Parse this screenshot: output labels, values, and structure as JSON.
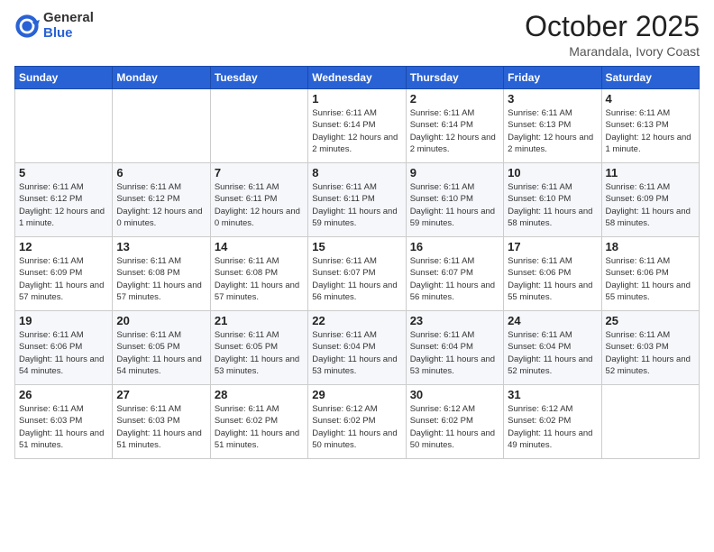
{
  "header": {
    "logo_general": "General",
    "logo_blue": "Blue",
    "month": "October 2025",
    "location": "Marandala, Ivory Coast"
  },
  "days_of_week": [
    "Sunday",
    "Monday",
    "Tuesday",
    "Wednesday",
    "Thursday",
    "Friday",
    "Saturday"
  ],
  "weeks": [
    [
      {
        "day": "",
        "info": ""
      },
      {
        "day": "",
        "info": ""
      },
      {
        "day": "",
        "info": ""
      },
      {
        "day": "1",
        "info": "Sunrise: 6:11 AM\nSunset: 6:14 PM\nDaylight: 12 hours and 2 minutes."
      },
      {
        "day": "2",
        "info": "Sunrise: 6:11 AM\nSunset: 6:14 PM\nDaylight: 12 hours and 2 minutes."
      },
      {
        "day": "3",
        "info": "Sunrise: 6:11 AM\nSunset: 6:13 PM\nDaylight: 12 hours and 2 minutes."
      },
      {
        "day": "4",
        "info": "Sunrise: 6:11 AM\nSunset: 6:13 PM\nDaylight: 12 hours and 1 minute."
      }
    ],
    [
      {
        "day": "5",
        "info": "Sunrise: 6:11 AM\nSunset: 6:12 PM\nDaylight: 12 hours and 1 minute."
      },
      {
        "day": "6",
        "info": "Sunrise: 6:11 AM\nSunset: 6:12 PM\nDaylight: 12 hours and 0 minutes."
      },
      {
        "day": "7",
        "info": "Sunrise: 6:11 AM\nSunset: 6:11 PM\nDaylight: 12 hours and 0 minutes."
      },
      {
        "day": "8",
        "info": "Sunrise: 6:11 AM\nSunset: 6:11 PM\nDaylight: 11 hours and 59 minutes."
      },
      {
        "day": "9",
        "info": "Sunrise: 6:11 AM\nSunset: 6:10 PM\nDaylight: 11 hours and 59 minutes."
      },
      {
        "day": "10",
        "info": "Sunrise: 6:11 AM\nSunset: 6:10 PM\nDaylight: 11 hours and 58 minutes."
      },
      {
        "day": "11",
        "info": "Sunrise: 6:11 AM\nSunset: 6:09 PM\nDaylight: 11 hours and 58 minutes."
      }
    ],
    [
      {
        "day": "12",
        "info": "Sunrise: 6:11 AM\nSunset: 6:09 PM\nDaylight: 11 hours and 57 minutes."
      },
      {
        "day": "13",
        "info": "Sunrise: 6:11 AM\nSunset: 6:08 PM\nDaylight: 11 hours and 57 minutes."
      },
      {
        "day": "14",
        "info": "Sunrise: 6:11 AM\nSunset: 6:08 PM\nDaylight: 11 hours and 57 minutes."
      },
      {
        "day": "15",
        "info": "Sunrise: 6:11 AM\nSunset: 6:07 PM\nDaylight: 11 hours and 56 minutes."
      },
      {
        "day": "16",
        "info": "Sunrise: 6:11 AM\nSunset: 6:07 PM\nDaylight: 11 hours and 56 minutes."
      },
      {
        "day": "17",
        "info": "Sunrise: 6:11 AM\nSunset: 6:06 PM\nDaylight: 11 hours and 55 minutes."
      },
      {
        "day": "18",
        "info": "Sunrise: 6:11 AM\nSunset: 6:06 PM\nDaylight: 11 hours and 55 minutes."
      }
    ],
    [
      {
        "day": "19",
        "info": "Sunrise: 6:11 AM\nSunset: 6:06 PM\nDaylight: 11 hours and 54 minutes."
      },
      {
        "day": "20",
        "info": "Sunrise: 6:11 AM\nSunset: 6:05 PM\nDaylight: 11 hours and 54 minutes."
      },
      {
        "day": "21",
        "info": "Sunrise: 6:11 AM\nSunset: 6:05 PM\nDaylight: 11 hours and 53 minutes."
      },
      {
        "day": "22",
        "info": "Sunrise: 6:11 AM\nSunset: 6:04 PM\nDaylight: 11 hours and 53 minutes."
      },
      {
        "day": "23",
        "info": "Sunrise: 6:11 AM\nSunset: 6:04 PM\nDaylight: 11 hours and 53 minutes."
      },
      {
        "day": "24",
        "info": "Sunrise: 6:11 AM\nSunset: 6:04 PM\nDaylight: 11 hours and 52 minutes."
      },
      {
        "day": "25",
        "info": "Sunrise: 6:11 AM\nSunset: 6:03 PM\nDaylight: 11 hours and 52 minutes."
      }
    ],
    [
      {
        "day": "26",
        "info": "Sunrise: 6:11 AM\nSunset: 6:03 PM\nDaylight: 11 hours and 51 minutes."
      },
      {
        "day": "27",
        "info": "Sunrise: 6:11 AM\nSunset: 6:03 PM\nDaylight: 11 hours and 51 minutes."
      },
      {
        "day": "28",
        "info": "Sunrise: 6:11 AM\nSunset: 6:02 PM\nDaylight: 11 hours and 51 minutes."
      },
      {
        "day": "29",
        "info": "Sunrise: 6:12 AM\nSunset: 6:02 PM\nDaylight: 11 hours and 50 minutes."
      },
      {
        "day": "30",
        "info": "Sunrise: 6:12 AM\nSunset: 6:02 PM\nDaylight: 11 hours and 50 minutes."
      },
      {
        "day": "31",
        "info": "Sunrise: 6:12 AM\nSunset: 6:02 PM\nDaylight: 11 hours and 49 minutes."
      },
      {
        "day": "",
        "info": ""
      }
    ]
  ]
}
